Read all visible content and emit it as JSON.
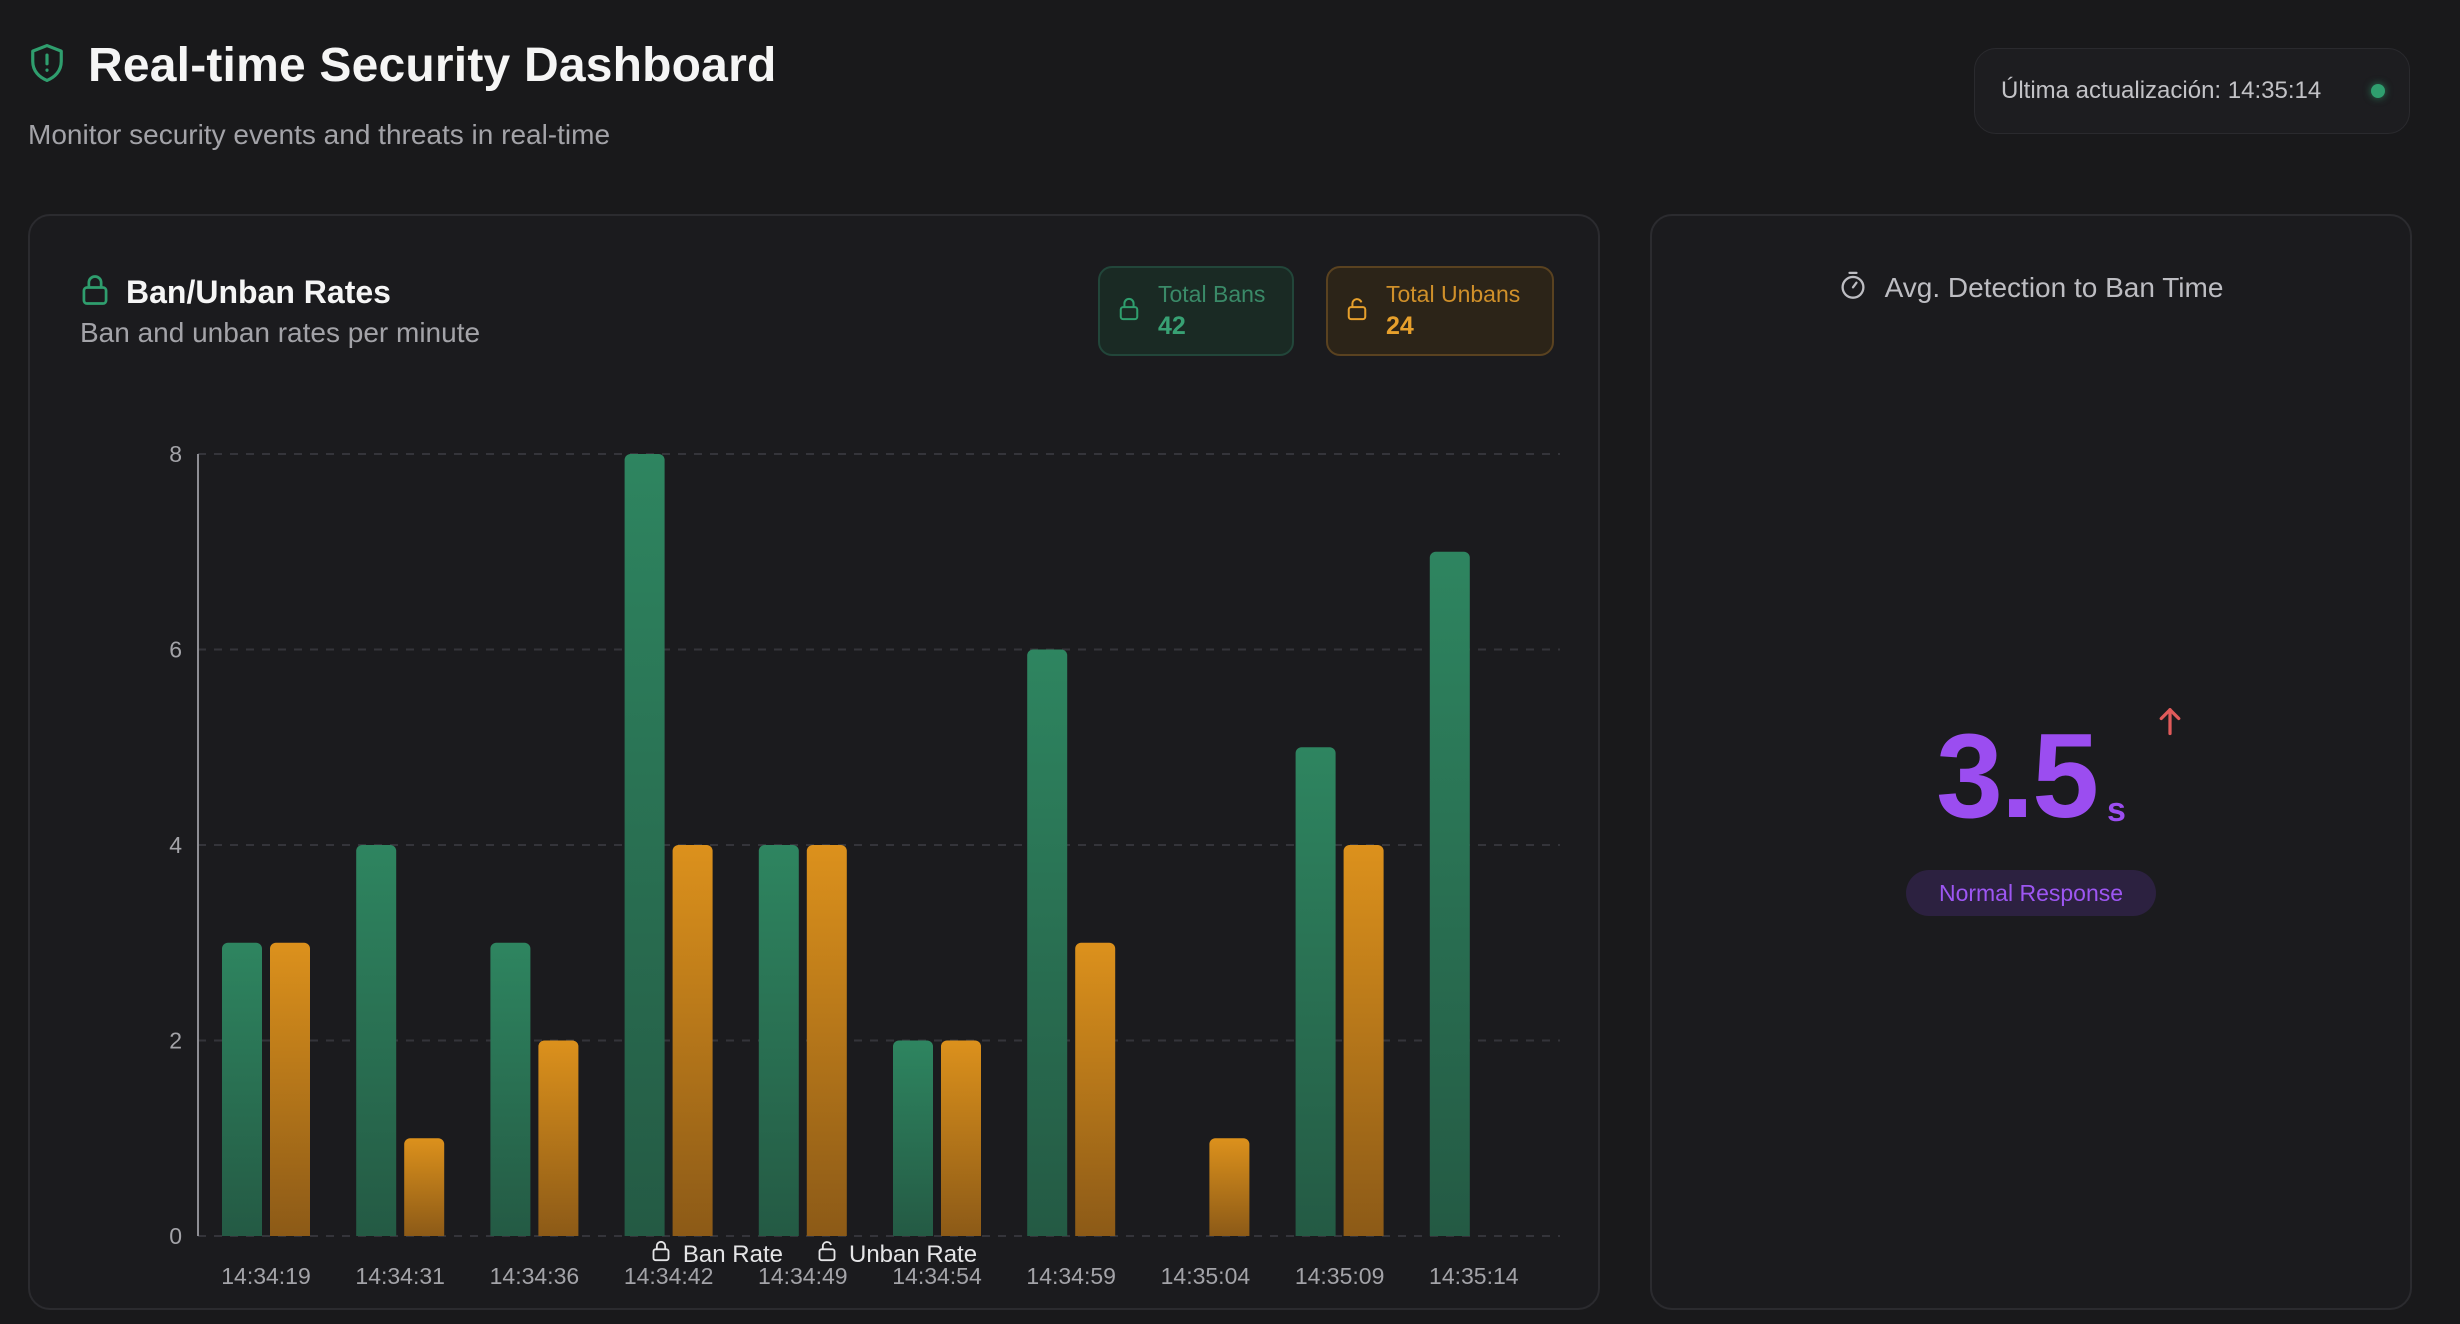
{
  "header": {
    "title": "Real-time Security Dashboard",
    "subtitle": "Monitor security events and threats in real-time",
    "last_update": "Última actualización: 14:35:14",
    "shield_icon": "shield-alert-icon",
    "live_color": "#2f9e6e"
  },
  "rates_card": {
    "title": "Ban/Unban Rates",
    "subtitle": "Ban and unban rates per minute",
    "total_bans_label": "Total Bans",
    "total_bans_value": "42",
    "total_unbans_label": "Total Unbans",
    "total_unbans_value": "24",
    "icon": "lock-icon"
  },
  "chart_data": {
    "type": "bar",
    "categories": [
      "14:34:19",
      "14:34:31",
      "14:34:36",
      "14:34:42",
      "14:34:49",
      "14:34:54",
      "14:34:59",
      "14:35:04",
      "14:35:09",
      "14:35:14"
    ],
    "series": [
      {
        "name": "Ban Rate",
        "values": [
          3,
          4,
          3,
          8,
          4,
          2,
          6,
          0,
          5,
          7
        ],
        "color": "#2d7d5a"
      },
      {
        "name": "Unban Rate",
        "values": [
          3,
          1,
          2,
          4,
          4,
          2,
          3,
          1,
          4,
          0
        ],
        "color": "#d98b1c"
      }
    ],
    "yticks": [
      0,
      2,
      4,
      6,
      8
    ],
    "ylim": [
      0,
      8
    ],
    "grid": true,
    "legend": "bottom"
  },
  "detection_card": {
    "title": "Avg. Detection to Ban Time",
    "value": "3.5",
    "unit": "s",
    "status": "Normal Response",
    "icon": "timer-icon",
    "trend_icon": "arrow-up-icon",
    "accent": "#9b4df0",
    "trend_color": "#e05a5a"
  }
}
